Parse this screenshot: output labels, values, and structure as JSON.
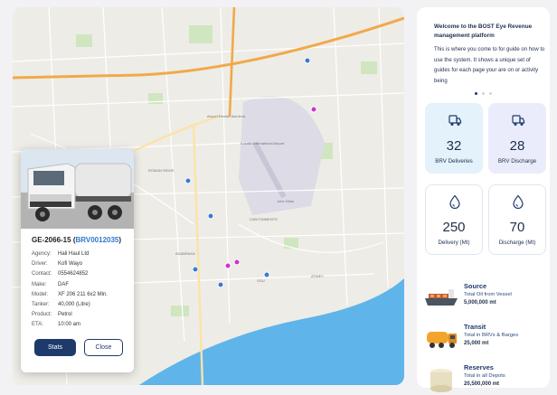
{
  "map": {
    "labels": [
      "Airport Residential Area",
      "Jubs Villas",
      "Kotoka International Airport",
      "CANTONMENTS",
      "ROMAN RIDGE",
      "ADABRAKA",
      "OSU",
      "ATWEY"
    ],
    "colors": {
      "land": "#eeece6",
      "park": "#cfe6c0",
      "sea": "#5fb4ea",
      "road": "#ffffff",
      "highway": "#f0a94a",
      "marker_blue": "#3a7ad6",
      "marker_magenta": "#cc33cc"
    }
  },
  "vehicle_card": {
    "plate": "GE-2066-15",
    "code": "BRV0012035",
    "details": [
      {
        "label": "Agency:",
        "value": "Hali Haul Ltd"
      },
      {
        "label": "Driver:",
        "value": "Kofi Wayo"
      },
      {
        "label": "Contact:",
        "value": "0554624852"
      },
      {
        "label": "Make:",
        "value": "DAF"
      },
      {
        "label": "Model:",
        "value": "XF 206 211 6x2 Min."
      },
      {
        "label": "Tanker:",
        "value": "40,000 (Litre)"
      },
      {
        "label": "Product:",
        "value": "Petrol"
      },
      {
        "label": "ETA:",
        "value": "10:00 am"
      }
    ],
    "stats_label": "Stats",
    "close_label": "Close"
  },
  "panel": {
    "intro_title": "Welcome to the BOST Eye Revenue management platform",
    "intro_body": "This is where you come to for guide on how to use the system. It shows a unique set of guides for each page your are on or activity being",
    "tiles": [
      {
        "value": "32",
        "label": "BRV Deliveries",
        "icon": "truck-icon"
      },
      {
        "value": "28",
        "label": "BRV Discharge",
        "icon": "truck-icon"
      },
      {
        "value": "250",
        "label": "Delivery (Mt)",
        "icon": "drop-icon"
      },
      {
        "value": "70",
        "label": "Discharge (Mt)",
        "icon": "drop-icon"
      }
    ],
    "stats": [
      {
        "title": "Source",
        "subtitle": "Total Oil from Vessel",
        "value": "5,000,000 mt",
        "icon": "tanker-ship-icon"
      },
      {
        "title": "Transit",
        "subtitle": "Total in BRVs & Barges",
        "value": "25,000 mt",
        "icon": "fuel-truck-icon"
      },
      {
        "title": "Reserves",
        "subtitle": "Total in all Depots",
        "value": "20,500,000 mt",
        "icon": "storage-tank-icon"
      }
    ]
  }
}
